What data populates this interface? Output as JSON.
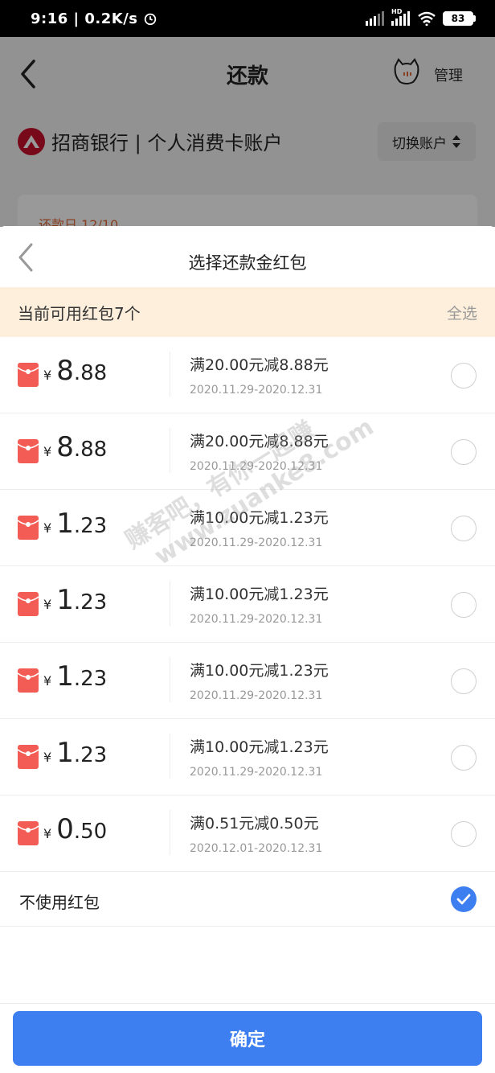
{
  "status_bar": {
    "time": "9:16 | 0.2K/s",
    "battery": "83",
    "network_label": "HD"
  },
  "background_page": {
    "title": "还款",
    "manage_label": "管理",
    "bank_name": "招商银行 | 个人消费卡账户",
    "switch_account_label": "切换账户",
    "due_date_text": "还款日 12/10"
  },
  "sheet": {
    "title": "选择还款金红包",
    "available_text": "当前可用红包7个",
    "select_all_label": "全选",
    "coupons": [
      {
        "int": "8",
        "dec": ".88",
        "rule": "满20.00元减8.88元",
        "date": "2020.11.29-2020.12.31",
        "selected": false
      },
      {
        "int": "8",
        "dec": ".88",
        "rule": "满20.00元减8.88元",
        "date": "2020.11.29-2020.12.31",
        "selected": false
      },
      {
        "int": "1",
        "dec": ".23",
        "rule": "满10.00元减1.23元",
        "date": "2020.11.29-2020.12.31",
        "selected": false
      },
      {
        "int": "1",
        "dec": ".23",
        "rule": "满10.00元减1.23元",
        "date": "2020.11.29-2020.12.31",
        "selected": false
      },
      {
        "int": "1",
        "dec": ".23",
        "rule": "满10.00元减1.23元",
        "date": "2020.11.29-2020.12.31",
        "selected": false
      },
      {
        "int": "1",
        "dec": ".23",
        "rule": "满10.00元减1.23元",
        "date": "2020.11.29-2020.12.31",
        "selected": false
      },
      {
        "int": "0",
        "dec": ".50",
        "rule": "满0.51元减0.50元",
        "date": "2020.12.01-2020.12.31",
        "selected": false
      }
    ],
    "currency_symbol": "¥",
    "no_use_label": "不使用红包",
    "no_use_selected": true,
    "confirm_label": "确定"
  },
  "watermark": {
    "line1": "赚客吧，有你一起赚",
    "line2": "www.zuanke8.com"
  },
  "colors": {
    "accent_blue": "#3d7ef0",
    "packet_red": "#f25c54",
    "banner_bg": "#fdefdc"
  }
}
